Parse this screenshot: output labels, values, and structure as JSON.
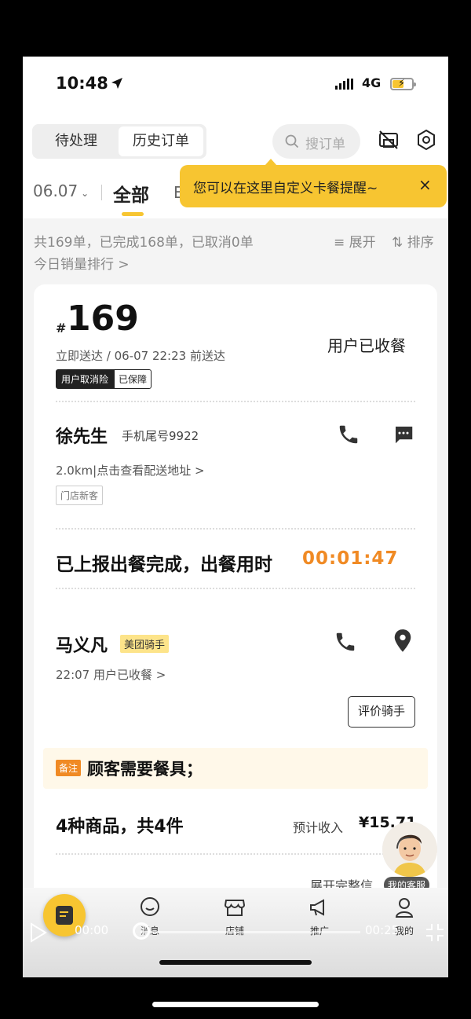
{
  "status_bar": {
    "time": "10:48",
    "network": "4G"
  },
  "header": {
    "tabs": [
      "待处理",
      "历史订单"
    ],
    "search_placeholder": "搜订单",
    "date": "06.07",
    "filter_all": "全部",
    "filter_second_partial": "E"
  },
  "tooltip": {
    "text": "您可以在这里自定义卡餐提醒~",
    "close": "×"
  },
  "summary": {
    "text": "共169单，已完成168单，已取消0单",
    "ranking": "今日销量排行 >",
    "expand": "展开",
    "sort": "排序"
  },
  "order": {
    "hash": "#",
    "number": "169",
    "eta": "立即送达 / 06-07 22:23 前送达",
    "status": "用户已收餐",
    "badges": [
      "用户取消险",
      "已保障"
    ],
    "customer_name": "徐先生",
    "customer_phone": "手机尾号9922",
    "distance": "2.0km|点击查看配送地址 >",
    "customer_tag": "门店新客",
    "meal_text": "已上报出餐完成，出餐用时",
    "meal_time": "00:01:47",
    "rider_name": "马义凡",
    "rider_tag": "美团骑手",
    "rider_status": "22:07  用户已收餐 >",
    "rate_rider": "评价骑手",
    "note_tag": "备注",
    "note_text": "顾客需要餐具；",
    "items_summary": "4种商品，共4件",
    "income_label": "预计收入",
    "income_value": "¥15.71",
    "expand_full": "展开完整信"
  },
  "customer_service": {
    "label": "我的客服"
  },
  "bottom_nav": {
    "items": [
      "消息",
      "店铺",
      "推广",
      "我的"
    ]
  },
  "video": {
    "current": "00:00",
    "total": "00:25"
  },
  "colors": {
    "accent": "#f7c531",
    "orange": "#f08a24",
    "background": "#f4f4f4"
  }
}
